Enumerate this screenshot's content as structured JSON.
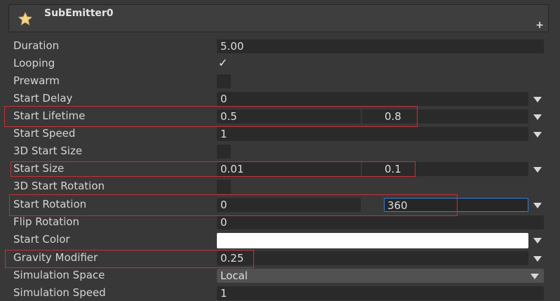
{
  "module": {
    "title": "SubEmitter0",
    "icon": "star-icon",
    "add_icon": "plus-icon"
  },
  "properties": {
    "duration": {
      "label": "Duration",
      "value": "5.00"
    },
    "looping": {
      "label": "Looping",
      "checked": true
    },
    "prewarm": {
      "label": "Prewarm",
      "checked": false
    },
    "start_delay": {
      "label": "Start Delay",
      "value": "0"
    },
    "start_lifetime": {
      "label": "Start Lifetime",
      "min": "0.5",
      "max": "0.8"
    },
    "start_speed": {
      "label": "Start Speed",
      "value": "1"
    },
    "start_size_3d": {
      "label": "3D Start Size",
      "checked": false
    },
    "start_size": {
      "label": "Start Size",
      "min": "0.01",
      "max": "0.1"
    },
    "start_rotation_3d": {
      "label": "3D Start Rotation",
      "checked": false
    },
    "start_rotation": {
      "label": "Start Rotation",
      "min": "0",
      "max": "360"
    },
    "flip_rotation": {
      "label": "Flip Rotation",
      "value": "0"
    },
    "start_color": {
      "label": "Start Color",
      "color": "#ffffff"
    },
    "gravity_modifier": {
      "label": "Gravity Modifier",
      "value": "0.25"
    },
    "simulation_space": {
      "label": "Simulation Space",
      "value": "Local"
    },
    "simulation_speed": {
      "label": "Simulation Speed",
      "value": "1"
    }
  },
  "highlight_color": "#c8303a",
  "focus_color": "#3d7bd0"
}
